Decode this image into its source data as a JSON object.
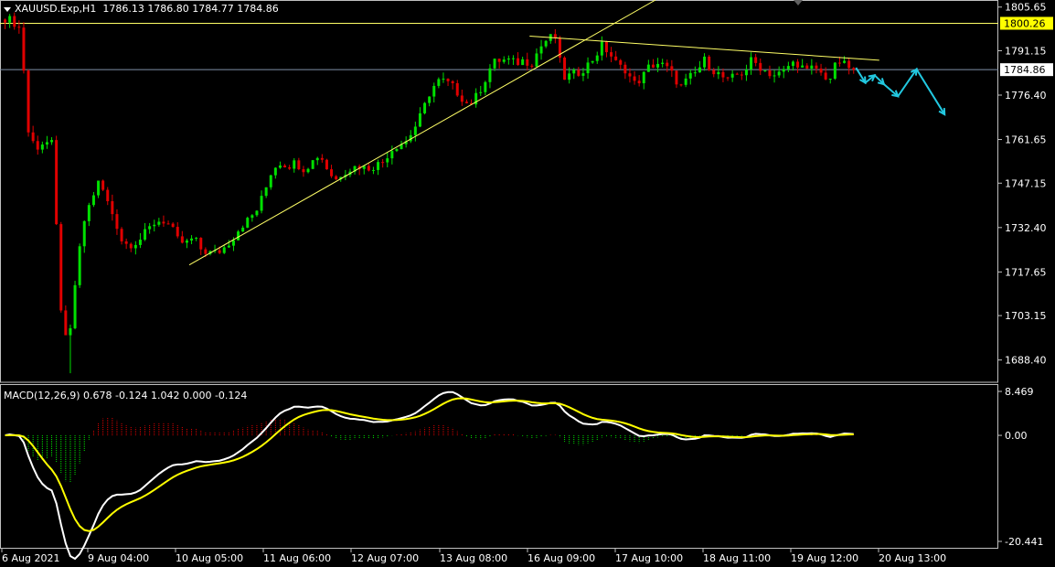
{
  "header": {
    "symbol": "XAUUSD.Exp,H1",
    "ohlc": "1786.13 1786.80 1784.77 1784.86"
  },
  "macd": {
    "label": "MACD(12,26,9) 0.678 -0.124 1.042 0.000 -0.124",
    "ticks": [
      {
        "value": 8.469,
        "label": "8.469"
      },
      {
        "value": 0.0,
        "label": "0.00"
      },
      {
        "value": -20.441,
        "label": "-20.441"
      }
    ],
    "range": [
      -20.441,
      8.469
    ]
  },
  "colors": {
    "background": "#000000",
    "bull": "#00e000",
    "bear": "#e00000",
    "trendline": "#ffff66",
    "price_line": "#8090a8",
    "forecast": "#22c8e0",
    "macd_line": "#ffffff",
    "signal_line": "#ffff00"
  },
  "chart_data": {
    "type": "candlestick",
    "title": "XAUUSD.Exp,H1",
    "ylim": [
      1681,
      1808
    ],
    "y_ticks": [
      {
        "value": 1805.65,
        "label": "1805.65"
      },
      {
        "value": 1791.15,
        "label": "1791.15"
      },
      {
        "value": 1776.4,
        "label": "1776.40"
      },
      {
        "value": 1761.65,
        "label": "1761.65"
      },
      {
        "value": 1747.15,
        "label": "1747.15"
      },
      {
        "value": 1732.4,
        "label": "1732.40"
      },
      {
        "value": 1717.65,
        "label": "1717.65"
      },
      {
        "value": 1703.15,
        "label": "1703.15"
      },
      {
        "value": 1688.4,
        "label": "1688.40"
      }
    ],
    "x_ticks": [
      "6 Aug 2021",
      "9 Aug 04:00",
      "10 Aug 05:00",
      "11 Aug 06:00",
      "12 Aug 07:00",
      "13 Aug 08:00",
      "16 Aug 09:00",
      "17 Aug 10:00",
      "18 Aug 11:00",
      "19 Aug 12:00",
      "20 Aug 13:00"
    ],
    "price_labels": [
      {
        "value": 1800.26,
        "label": "1800.26",
        "style": "hline-yellow"
      },
      {
        "value": 1784.86,
        "label": "1784.86",
        "style": "current-price"
      }
    ],
    "close_anchors": [
      1802,
      1801,
      1798,
      1763,
      1759,
      1761,
      1760,
      1708,
      1690,
      1716,
      1734,
      1742,
      1748,
      1741,
      1735,
      1727,
      1727,
      1728,
      1731,
      1734,
      1735,
      1733,
      1728,
      1727,
      1729,
      1725,
      1724,
      1724,
      1726,
      1729,
      1733,
      1735,
      1738,
      1744,
      1752,
      1754,
      1753,
      1754,
      1752,
      1754,
      1757,
      1752,
      1748,
      1751,
      1752,
      1753,
      1752,
      1753,
      1754,
      1758,
      1760,
      1761,
      1765,
      1770,
      1777,
      1781,
      1781,
      1779,
      1776,
      1773,
      1776,
      1781,
      1787,
      1788,
      1788,
      1787,
      1788,
      1787,
      1792,
      1795,
      1796,
      1782,
      1783,
      1784,
      1786,
      1789,
      1793,
      1790,
      1786,
      1785,
      1780,
      1782,
      1786,
      1787,
      1786,
      1783,
      1779,
      1782,
      1784,
      1788,
      1785,
      1783,
      1781,
      1783,
      1784,
      1788,
      1786,
      1784,
      1783,
      1784,
      1787,
      1787,
      1784,
      1786,
      1783,
      1782,
      1788,
      1786,
      1784.86
    ],
    "trendlines": [
      {
        "from": {
          "bar": 40,
          "price": 1720
        },
        "to": {
          "bar": 140,
          "price": 1808
        },
        "name": "ascending-trendline"
      },
      {
        "from": {
          "bar": 113,
          "price": 1796
        },
        "to": {
          "bar": 188,
          "price": 1788
        },
        "name": "descending-trendline"
      }
    ],
    "forecast": [
      {
        "bar": 183,
        "price": 1785.5
      },
      {
        "bar": 185,
        "price": 1780.5
      },
      {
        "bar": 187,
        "price": 1783
      },
      {
        "bar": 189,
        "price": 1780
      },
      {
        "bar": 192,
        "price": 1776
      },
      {
        "bar": 196,
        "price": 1785
      },
      {
        "bar": 202,
        "price": 1770
      }
    ]
  }
}
